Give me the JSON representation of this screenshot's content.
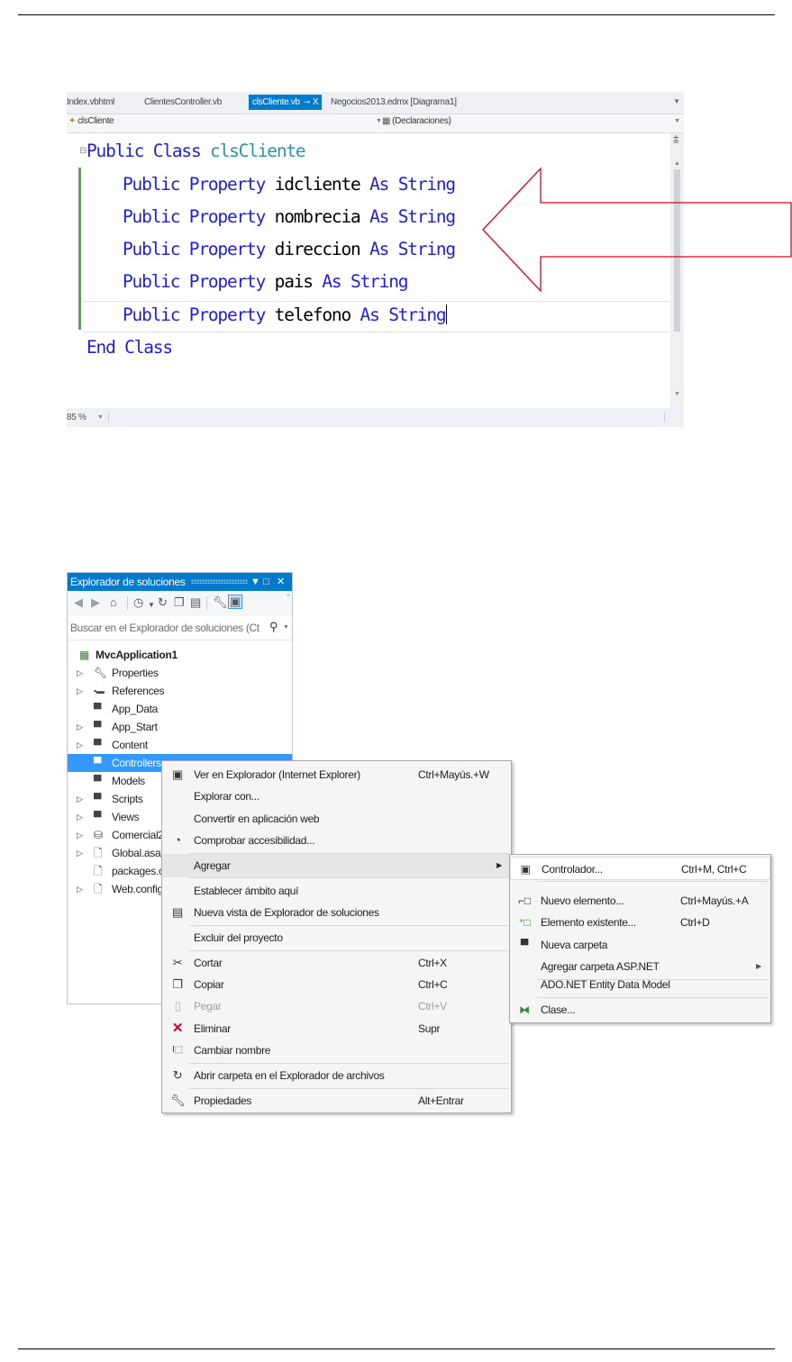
{
  "editor": {
    "tabs": [
      {
        "label": "Index.vbhtml"
      },
      {
        "label": "ClientesController.vb"
      },
      {
        "label": "clsCliente.vb",
        "pin": "⊸",
        "close": "X",
        "active": true
      },
      {
        "label": "Negocios2013.edmx [Diagrama1]"
      }
    ],
    "nav_left": "clsCliente",
    "nav_right": "(Declaraciones)",
    "code": {
      "kw_public": "Public",
      "kw_class": "Class",
      "class_name": "clsCliente",
      "kw_property": "Property",
      "kw_as": "As",
      "type_string": "String",
      "properties": [
        "idcliente",
        "nombrecia",
        "direccion",
        "pais",
        "telefono"
      ],
      "kw_end": "End"
    },
    "zoom": "85 %"
  },
  "solution_explorer": {
    "title": "Explorador de soluciones",
    "search_placeholder": "Buscar en el Explorador de soluciones (Ct",
    "project": "MvcApplication1",
    "items": [
      {
        "label": "Properties",
        "expandable": true,
        "icon": "wrench-icon"
      },
      {
        "label": "References",
        "expandable": true,
        "icon": "references-icon"
      },
      {
        "label": "App_Data",
        "expandable": false,
        "icon": "folder-icon"
      },
      {
        "label": "App_Start",
        "expandable": true,
        "icon": "folder-icon"
      },
      {
        "label": "Content",
        "expandable": true,
        "icon": "folder-icon"
      },
      {
        "label": "Controllers",
        "expandable": false,
        "icon": "folder-icon",
        "selected": true
      },
      {
        "label": "Models",
        "expandable": false,
        "icon": "folder-icon"
      },
      {
        "label": "Scripts",
        "expandable": true,
        "icon": "folder-icon"
      },
      {
        "label": "Views",
        "expandable": true,
        "icon": "folder-icon"
      },
      {
        "label": "Comercial2",
        "expandable": true,
        "icon": "database-icon"
      },
      {
        "label": "Global.asax",
        "expandable": true,
        "icon": "file-icon"
      },
      {
        "label": "packages.c",
        "expandable": false,
        "icon": "file-icon"
      },
      {
        "label": "Web.config",
        "expandable": true,
        "icon": "file-icon"
      }
    ]
  },
  "context_menu": {
    "items": [
      {
        "label": "Ver en Explorador (Internet Explorer)",
        "shortcut": "Ctrl+Mayús.+W",
        "icon": "browser-icon"
      },
      {
        "label": "Explorar con...",
        "shortcut": "",
        "icon": ""
      },
      {
        "label": "Convertir en aplicación web",
        "shortcut": "",
        "icon": ""
      },
      {
        "label": "Comprobar accesibilidad...",
        "shortcut": "",
        "icon": "accessibility-icon"
      },
      {
        "label": "Agregar",
        "shortcut": "",
        "icon": "",
        "submenu": true
      },
      {
        "label": "Establecer ámbito aquí",
        "shortcut": "",
        "icon": ""
      },
      {
        "label": "Nueva vista de Explorador de soluciones",
        "shortcut": "",
        "icon": "new-view-icon"
      },
      {
        "label": "Excluir del proyecto",
        "shortcut": "",
        "icon": ""
      },
      {
        "label": "Cortar",
        "shortcut": "Ctrl+X",
        "icon": "cut-icon"
      },
      {
        "label": "Copiar",
        "shortcut": "Ctrl+C",
        "icon": "copy-icon"
      },
      {
        "label": "Pegar",
        "shortcut": "Ctrl+V",
        "icon": "paste-icon",
        "disabled": true
      },
      {
        "label": "Eliminar",
        "shortcut": "Supr",
        "icon": "delete-icon"
      },
      {
        "label": "Cambiar nombre",
        "shortcut": "",
        "icon": "rename-icon"
      },
      {
        "label": "Abrir carpeta en el Explorador de archivos",
        "shortcut": "",
        "icon": "open-folder-icon"
      },
      {
        "label": "Propiedades",
        "shortcut": "Alt+Entrar",
        "icon": "wrench-icon"
      }
    ]
  },
  "submenu": {
    "items": [
      {
        "label": "Controlador...",
        "shortcut": "Ctrl+M, Ctrl+C",
        "icon": "controller-icon"
      },
      {
        "label": "Nuevo elemento...",
        "shortcut": "Ctrl+Mayús.+A",
        "icon": "new-item-icon"
      },
      {
        "label": "Elemento existente...",
        "shortcut": "Ctrl+D",
        "icon": "existing-item-icon"
      },
      {
        "label": "Nueva carpeta",
        "shortcut": "",
        "icon": "new-folder-icon"
      },
      {
        "label": "Agregar carpeta ASP.NET",
        "shortcut": "",
        "icon": "",
        "submenu": true
      },
      {
        "label": "ADO.NET Entity Data Model",
        "shortcut": "",
        "icon": ""
      },
      {
        "label": "Clase...",
        "shortcut": "",
        "icon": "class-icon"
      }
    ]
  },
  "colors": {
    "accent": "#007acc",
    "keyword": "#1f1fd6",
    "type": "#2b91af",
    "annotation_arrow": "#e0001a",
    "selection": "#3399ff"
  }
}
